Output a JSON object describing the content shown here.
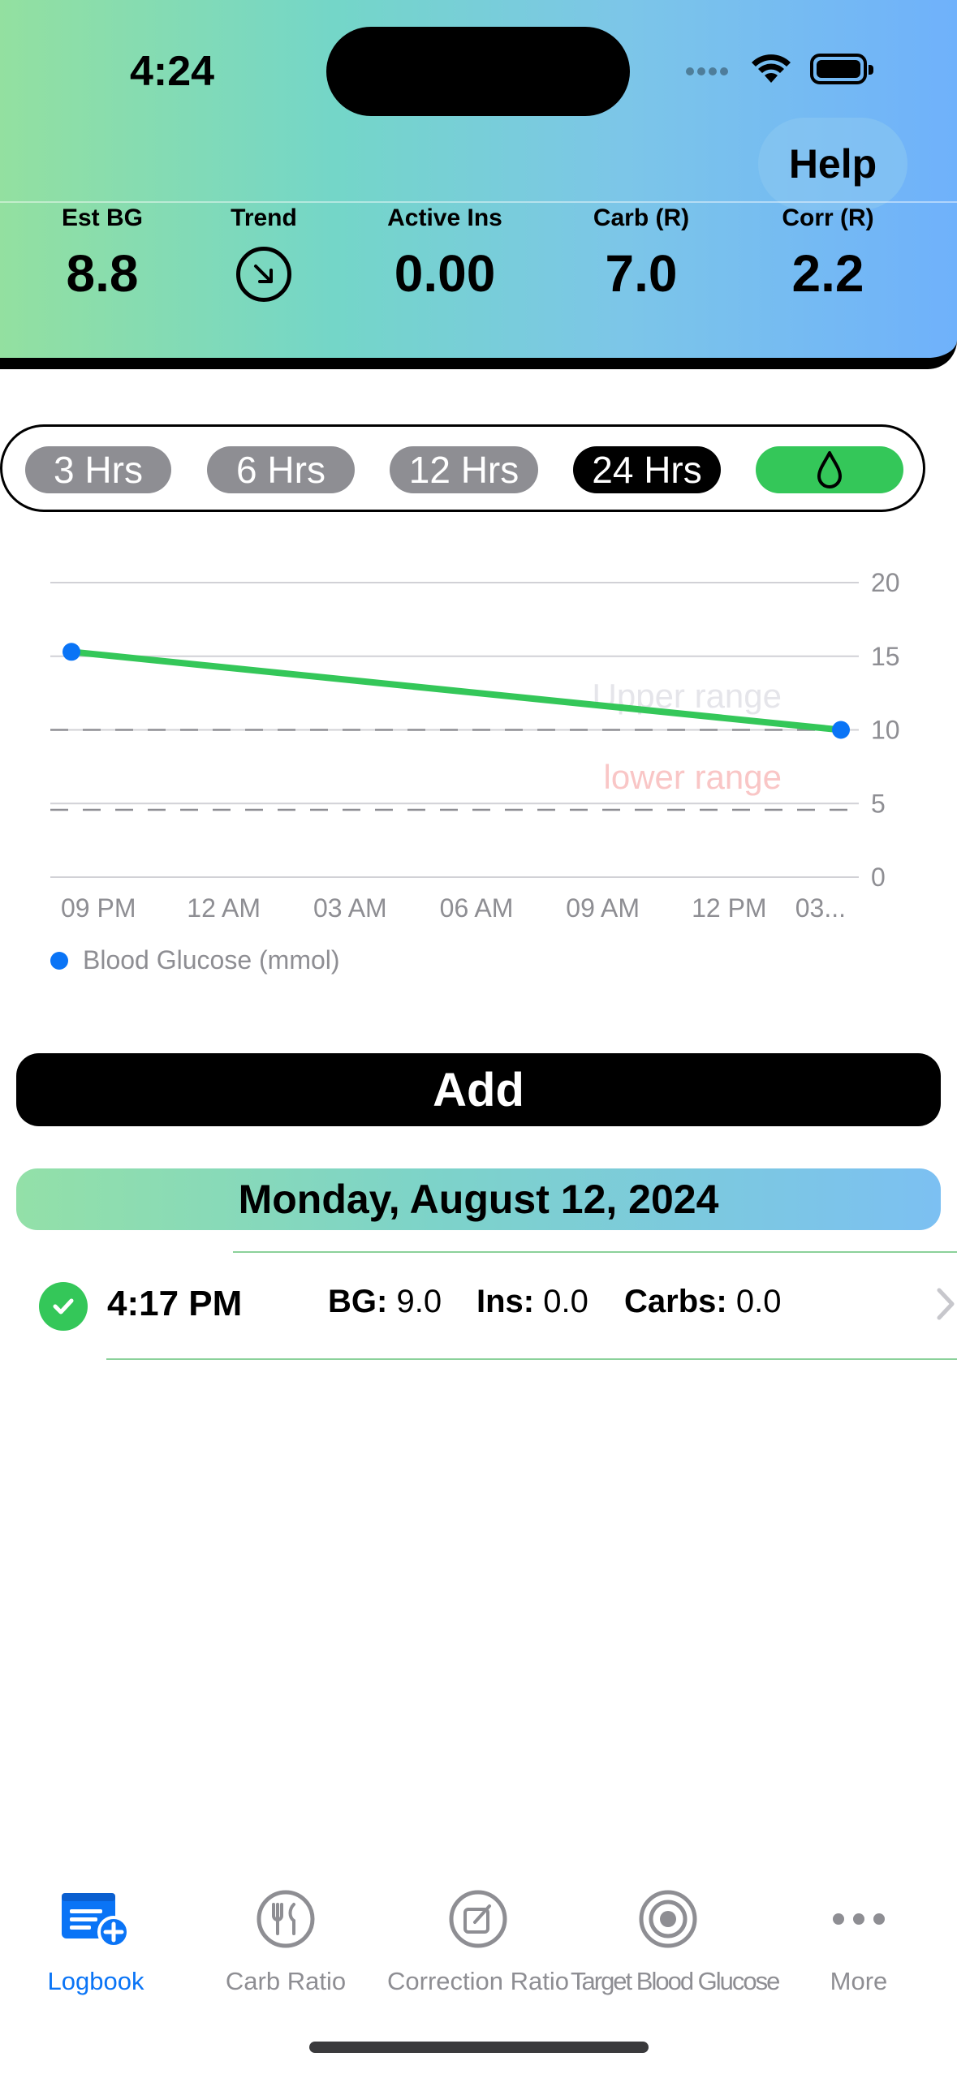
{
  "status_bar": {
    "time": "4:24"
  },
  "header": {
    "help_label": "Help",
    "stats": [
      {
        "label": "Est BG",
        "value": "8.8"
      },
      {
        "label": "Trend",
        "icon": "arrow-down-right-circle-icon"
      },
      {
        "label": "Active Ins",
        "value": "0.00"
      },
      {
        "label": "Carb (R)",
        "value": "7.0"
      },
      {
        "label": "Corr (R)",
        "value": "2.2"
      }
    ]
  },
  "range_selector": {
    "options": [
      "3 Hrs",
      "6 Hrs",
      "12 Hrs",
      "24 Hrs"
    ],
    "selected": "24 Hrs",
    "drop_icon": "drop-icon",
    "colors": {
      "selected": "#000000",
      "unselected": "#8e8e93",
      "drop": "#34c759"
    }
  },
  "chart_data": {
    "type": "line",
    "x_tick_labels": [
      "09 PM",
      "12 AM",
      "03 AM",
      "06 AM",
      "09 AM",
      "12 PM",
      "03..."
    ],
    "y_ticks": [
      0,
      5,
      10,
      15,
      20
    ],
    "ylim": [
      0,
      20
    ],
    "grid": true,
    "series": [
      {
        "name": "Blood Glucose (mmol)",
        "x": [
          "09 PM",
          "03..."
        ],
        "values": [
          15.3,
          10.0
        ],
        "line_color": "#34c759",
        "point_color": "#0a74f6"
      }
    ],
    "annotations": [
      {
        "text": "Upper range",
        "y": 10,
        "color": "#e5e5ea"
      },
      {
        "text": "lower range",
        "y": 4.5,
        "color": "#f9c6c6"
      }
    ],
    "legend": "bottom-left"
  },
  "add_button_label": "Add",
  "date_header": "Monday, August 12, 2024",
  "entries": [
    {
      "time": "4:17 PM",
      "bg_label": "BG:",
      "bg_value": "9.0",
      "ins_label": "Ins:",
      "ins_value": "0.0",
      "carbs_label": "Carbs:",
      "carbs_value": "0.0"
    }
  ],
  "tab_bar": {
    "tabs": [
      {
        "label": "Logbook",
        "icon": "logbook-icon",
        "active": true
      },
      {
        "label": "Carb Ratio",
        "icon": "fork-knife-icon",
        "active": false
      },
      {
        "label": "Correction Ratio",
        "icon": "edit-square-icon",
        "active": false
      },
      {
        "label": "Target Blood Glucose",
        "icon": "target-icon",
        "active": false
      },
      {
        "label": "More",
        "icon": "more-dots-icon",
        "active": false
      }
    ],
    "active_color": "#0a74f6",
    "inactive_color": "#8e8e93"
  }
}
